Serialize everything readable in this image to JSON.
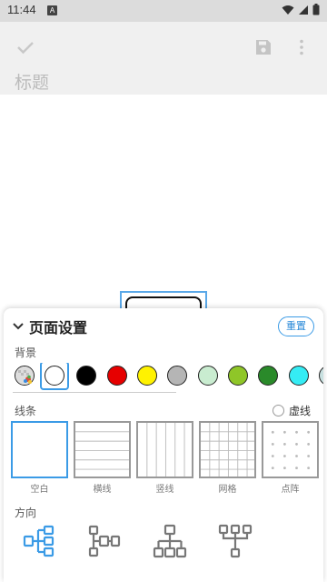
{
  "status_bar": {
    "time": "11:44",
    "badge": "A",
    "icons": [
      "wifi-icon",
      "signal-icon",
      "battery-icon"
    ]
  },
  "app_bar": {
    "icons": [
      "check-icon",
      "save-icon",
      "more-vert-icon"
    ],
    "title_placeholder": "标题"
  },
  "sheet": {
    "title": "页面设置",
    "reset_label": "重置",
    "background_label": "背景",
    "background_colors": [
      "#ffffff",
      "#000000",
      "#e60000",
      "#fff200",
      "#b5b5b5",
      "#c9ecd0",
      "#8fc628",
      "#2a8a2a",
      "#35ecf4",
      "#c8e0e0"
    ],
    "selected_background": "#ffffff",
    "line_label": "线条",
    "dashed_label": "虚线",
    "line_options": [
      "空白",
      "横线",
      "竖线",
      "网格",
      "点阵"
    ],
    "selected_line": "空白",
    "direction_label": "方向",
    "direction_icons": [
      "layout-right-icon",
      "layout-both-sides-icon",
      "layout-down-icon",
      "layout-tree-icon"
    ]
  },
  "accent_color": "#3b9be6"
}
